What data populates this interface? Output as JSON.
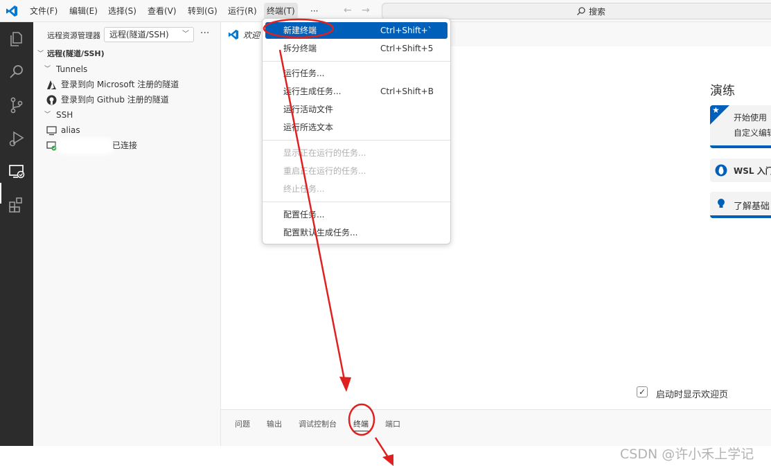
{
  "titlebar": {
    "menus": [
      "文件(F)",
      "编辑(E)",
      "选择(S)",
      "查看(V)",
      "转到(G)",
      "运行(R)",
      "终端(T)"
    ],
    "more": "···",
    "back": "←",
    "forward": "→",
    "search_placeholder": "搜索"
  },
  "sidebar": {
    "title": "远程资源管理器",
    "select_value": "远程(隧道/SSH)",
    "more": "···",
    "section": "远程(隧道/SSH)",
    "tunnels_label": "Tunnels",
    "tunnel_items": [
      "登录到向 Microsoft 注册的隧道",
      "登录到向 Github 注册的隧道"
    ],
    "ssh_label": "SSH",
    "ssh_hosts": [
      {
        "name": "alias",
        "status": ""
      },
      {
        "name": "",
        "status": "已连接"
      }
    ]
  },
  "editor": {
    "tab_label": "欢迎",
    "walkthrough_title": "演练",
    "cards": [
      {
        "line1": "开始使用",
        "line2": "自定义编辑"
      },
      {
        "line1": "WSL 入门"
      },
      {
        "line1": "了解基础"
      }
    ],
    "show_welcome_label": "启动时显示欢迎页",
    "show_welcome_checked": true
  },
  "panel": {
    "tabs": [
      "问题",
      "输出",
      "调试控制台",
      "终端",
      "端口"
    ],
    "active_tab": "终端"
  },
  "terminal_menu": {
    "groups": [
      [
        {
          "label": "新建终端",
          "shortcut": "Ctrl+Shift+`",
          "highlight": true
        },
        {
          "label": "拆分终端",
          "shortcut": "Ctrl+Shift+5"
        }
      ],
      [
        {
          "label": "运行任务..."
        },
        {
          "label": "运行生成任务...",
          "shortcut": "Ctrl+Shift+B"
        },
        {
          "label": "运行活动文件"
        },
        {
          "label": "运行所选文本"
        }
      ],
      [
        {
          "label": "显示正在运行的任务...",
          "disabled": true
        },
        {
          "label": "重启正在运行的任务...",
          "disabled": true
        },
        {
          "label": "终止任务...",
          "disabled": true
        }
      ],
      [
        {
          "label": "配置任务..."
        },
        {
          "label": "配置默认生成任务..."
        }
      ]
    ]
  },
  "watermark": "CSDN @许小禾上学记",
  "colors": {
    "accent": "#005fb8",
    "annotation": "#e02020",
    "activity_bar": "#2c2c2c"
  }
}
